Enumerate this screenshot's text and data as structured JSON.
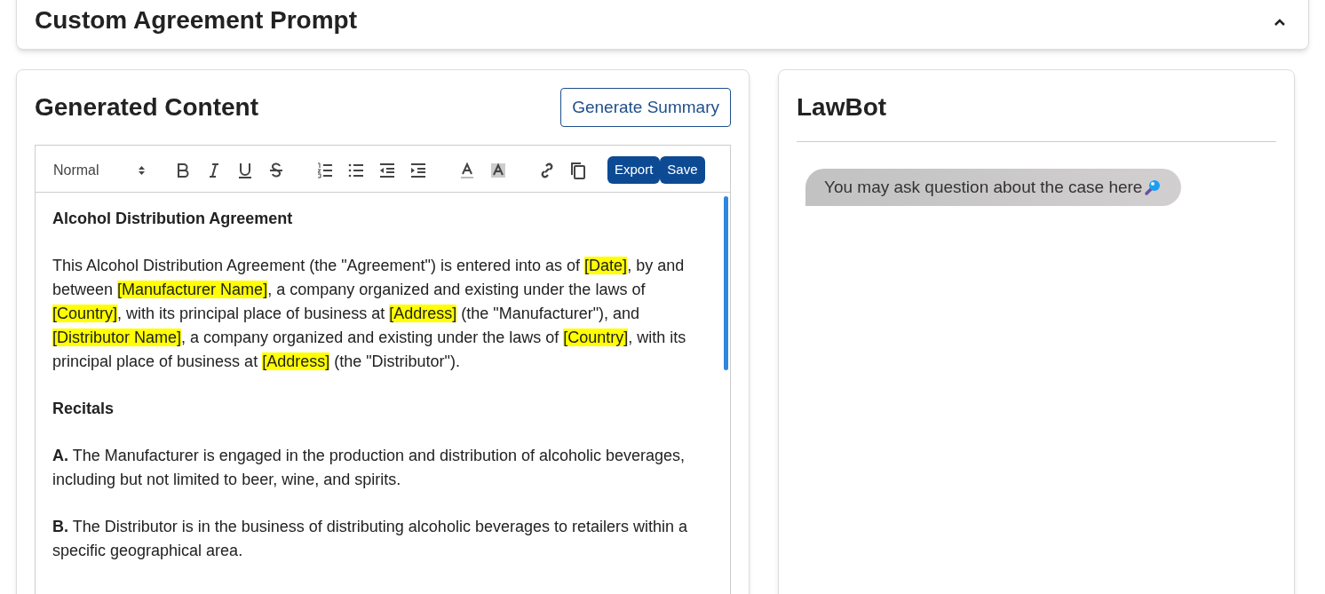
{
  "prompt_panel": {
    "title": "Custom Agreement Prompt",
    "expanded": true
  },
  "content_panel": {
    "title": "Generated Content",
    "summary_button": "Generate Summary",
    "toolbar": {
      "style_select": "Normal",
      "tools": [
        {
          "kind": "bold"
        },
        {
          "kind": "italic"
        },
        {
          "kind": "underline"
        },
        {
          "kind": "strike"
        },
        {
          "kind": "gap"
        },
        {
          "kind": "ordered-list"
        },
        {
          "kind": "bullet-list"
        },
        {
          "kind": "outdent"
        },
        {
          "kind": "indent"
        },
        {
          "kind": "gap"
        },
        {
          "kind": "text-color"
        },
        {
          "kind": "highlight"
        },
        {
          "kind": "gap"
        },
        {
          "kind": "link"
        },
        {
          "kind": "copy"
        }
      ],
      "buttons": [
        "Export",
        "Save"
      ]
    },
    "document": [
      {
        "kind": "heading",
        "segments": [
          {
            "text": "Alcohol Distribution Agreement",
            "highlighted": false
          }
        ]
      },
      {
        "kind": "body",
        "segments": [
          {
            "text": "This Alcohol Distribution Agreement (the \"Agreement\") is entered into as of ",
            "highlighted": false
          },
          {
            "text": "[Date]",
            "highlighted": true
          },
          {
            "text": ", by and between ",
            "highlighted": false
          },
          {
            "text": "[Manufacturer Name]",
            "highlighted": true
          },
          {
            "text": ", a company organized and existing under the laws of ",
            "highlighted": false
          },
          {
            "text": "[Country]",
            "highlighted": true
          },
          {
            "text": ", with its principal place of business at ",
            "highlighted": false
          },
          {
            "text": "[Address]",
            "highlighted": true
          },
          {
            "text": " (the \"Manufacturer\"), and ",
            "highlighted": false
          },
          {
            "text": "[Distributor Name]",
            "highlighted": true
          },
          {
            "text": ", a company organized and existing under the laws of ",
            "highlighted": false
          },
          {
            "text": "[Country]",
            "highlighted": true
          },
          {
            "text": ", with its principal place of business at ",
            "highlighted": false
          },
          {
            "text": "[Address]",
            "highlighted": true
          },
          {
            "text": " (the \"Distributor\").",
            "highlighted": false
          }
        ]
      },
      {
        "kind": "heading",
        "segments": [
          {
            "text": "Recitals",
            "highlighted": false
          }
        ]
      },
      {
        "kind": "body",
        "segments": [
          {
            "text": "**A.** The Manufacturer is engaged in the production and distribution of alcoholic beverages, including but not limited to beer, wine, and spirits.",
            "highlighted": false
          }
        ]
      },
      {
        "kind": "body",
        "segments": [
          {
            "text": "**B.** The Distributor is in the business of distributing alcoholic beverages to retailers within a specific geographical area.",
            "highlighted": false
          }
        ]
      }
    ]
  },
  "chat_panel": {
    "title": "LawBot",
    "messages": [
      {
        "text": "You may ask question about the case here"
      }
    ]
  }
}
